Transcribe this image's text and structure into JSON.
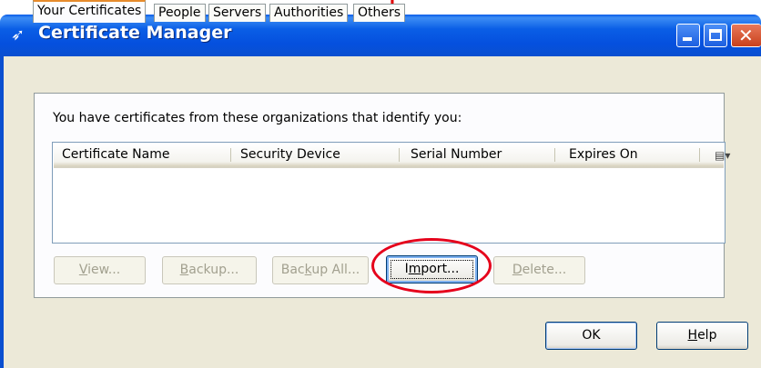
{
  "window": {
    "title": "Certificate Manager",
    "title_icon": "certificate-manager-icon",
    "controls": {
      "minimize": "minimize-icon",
      "maximize": "maximize-icon",
      "close": "close-icon"
    }
  },
  "tabs": [
    {
      "label": "Your Certificates",
      "active": true
    },
    {
      "label": "People",
      "active": false
    },
    {
      "label": "Servers",
      "active": false
    },
    {
      "label": "Authorities",
      "active": false
    },
    {
      "label": "Others",
      "active": false
    }
  ],
  "panel": {
    "description": "You have certificates from these organizations that identify you:",
    "columns": [
      "Certificate Name",
      "Security Device",
      "Serial Number",
      "Expires On"
    ],
    "column_picker_icon": "column-picker-icon",
    "rows": []
  },
  "actions": [
    {
      "label": "View...",
      "accel": "V",
      "enabled": false
    },
    {
      "label": "Backup...",
      "accel": "B",
      "enabled": false
    },
    {
      "label": "Backup All...",
      "accel": "k",
      "enabled": false
    },
    {
      "label": "Import...",
      "accel": "m",
      "enabled": true
    },
    {
      "label": "Delete...",
      "accel": "D",
      "enabled": false
    }
  ],
  "dialog_buttons": [
    {
      "label": "OK"
    },
    {
      "label": "Help",
      "accel": "H"
    }
  ],
  "annotation": {
    "color": "#e5001b"
  }
}
